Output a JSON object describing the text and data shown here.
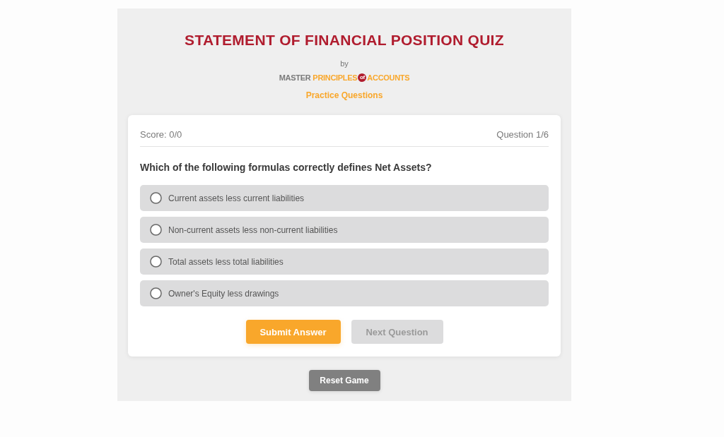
{
  "title": "STATEMENT OF FINANCIAL POSITION QUIZ",
  "byline": "by",
  "logo": [
    {
      "text": "MASTER",
      "kind": "plain"
    },
    {
      "text": "PRINCIPLES",
      "kind": "accent"
    },
    {
      "text": "of",
      "kind": "badge"
    },
    {
      "text": "ACCOUNTS",
      "kind": "accent"
    }
  ],
  "subtitle": "Practice Questions",
  "quiz": {
    "score": "Score: 0/0",
    "progress": "Question 1/6",
    "question": "Which of the following formulas correctly defines Net Assets?",
    "options": [
      {
        "text": "Current assets less current liabilities",
        "selected": false
      },
      {
        "text": "Non-current assets less non-current liabilities",
        "selected": false
      },
      {
        "text": "Total assets less total liabilities",
        "selected": false
      },
      {
        "text": "Owner's Equity less drawings",
        "selected": false
      }
    ],
    "buttons": [
      {
        "label": "Submit Answer",
        "disabled": false
      },
      {
        "label": "Next Question",
        "disabled": true
      }
    ]
  },
  "reset_button": {
    "label": "Reset Game"
  }
}
